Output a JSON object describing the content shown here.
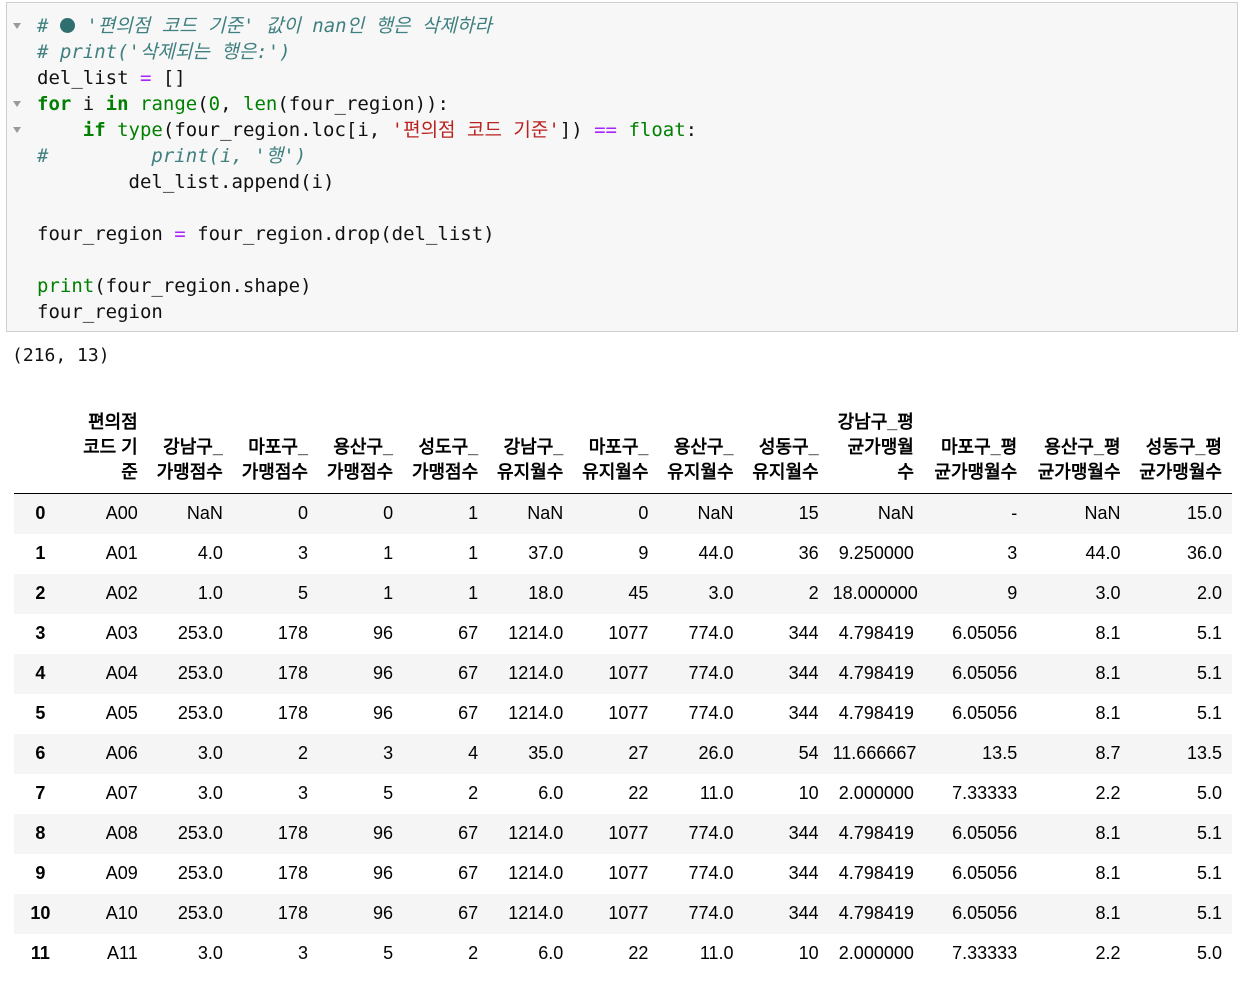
{
  "code_cell": {
    "lines": [
      [
        {
          "c": "cm",
          "t": "# "
        },
        {
          "c": "icon",
          "n": "dot-icon"
        },
        {
          "c": "cm",
          "t": " '편의점 코드 기준' 값이 nan인 행은 삭제하라"
        }
      ],
      [
        {
          "c": "cm",
          "t": "# print('삭제되는 행은:')"
        }
      ],
      [
        {
          "c": "",
          "t": "del_list "
        },
        {
          "c": "op",
          "t": "="
        },
        {
          "c": "",
          "t": " []"
        }
      ],
      [
        {
          "c": "kw",
          "t": "for"
        },
        {
          "c": "",
          "t": " i "
        },
        {
          "c": "kw",
          "t": "in"
        },
        {
          "c": "",
          "t": " "
        },
        {
          "c": "bi",
          "t": "range"
        },
        {
          "c": "",
          "t": "("
        },
        {
          "c": "nm",
          "t": "0"
        },
        {
          "c": "",
          "t": ", "
        },
        {
          "c": "bi",
          "t": "len"
        },
        {
          "c": "",
          "t": "(four_region)):"
        }
      ],
      [
        {
          "c": "",
          "t": "    "
        },
        {
          "c": "kw",
          "t": "if"
        },
        {
          "c": "",
          "t": " "
        },
        {
          "c": "bi",
          "t": "type"
        },
        {
          "c": "",
          "t": "(four_region.loc[i, "
        },
        {
          "c": "st",
          "t": "'편의점 코드 기준'"
        },
        {
          "c": "",
          "t": "]) "
        },
        {
          "c": "op",
          "t": "=="
        },
        {
          "c": "",
          "t": " "
        },
        {
          "c": "bi",
          "t": "float"
        },
        {
          "c": "",
          "t": ":"
        }
      ],
      [
        {
          "c": "cm",
          "t": "#         print(i, '행')"
        }
      ],
      [
        {
          "c": "",
          "t": "        del_list.append(i)"
        }
      ],
      [
        {
          "c": "",
          "t": ""
        }
      ],
      [
        {
          "c": "",
          "t": "four_region "
        },
        {
          "c": "op",
          "t": "="
        },
        {
          "c": "",
          "t": " four_region.drop(del_list)"
        }
      ],
      [
        {
          "c": "",
          "t": ""
        }
      ],
      [
        {
          "c": "bi",
          "t": "print"
        },
        {
          "c": "",
          "t": "(four_region.shape)"
        }
      ],
      [
        {
          "c": "",
          "t": "four_region"
        }
      ]
    ]
  },
  "stdout": "(216, 13)",
  "dataframe": {
    "columns": [
      "편의점 코드 기준",
      "강남구_가맹점수",
      "마포구_가맹점수",
      "용산구_가맹점수",
      "성도구_가맹점수",
      "강남구_유지월수",
      "마포구_유지월수",
      "용산구_유지월수",
      "성동구_유지월수",
      "강남구_평균가맹월수",
      "마포구_평균가맹월수",
      "용산구_평균가맹월수",
      "성동구_평균가맹월수"
    ],
    "rows": [
      {
        "index": "0",
        "values": [
          "A00",
          "NaN",
          "0",
          "0",
          "1",
          "NaN",
          "0",
          "NaN",
          "15",
          "NaN",
          "-",
          "NaN",
          "15.0"
        ]
      },
      {
        "index": "1",
        "values": [
          "A01",
          "4.0",
          "3",
          "1",
          "1",
          "37.0",
          "9",
          "44.0",
          "36",
          "9.250000",
          "3",
          "44.0",
          "36.0"
        ]
      },
      {
        "index": "2",
        "values": [
          "A02",
          "1.0",
          "5",
          "1",
          "1",
          "18.0",
          "45",
          "3.0",
          "2",
          "18.000000",
          "9",
          "3.0",
          "2.0"
        ]
      },
      {
        "index": "3",
        "values": [
          "A03",
          "253.0",
          "178",
          "96",
          "67",
          "1214.0",
          "1077",
          "774.0",
          "344",
          "4.798419",
          "6.05056",
          "8.1",
          "5.1"
        ]
      },
      {
        "index": "4",
        "values": [
          "A04",
          "253.0",
          "178",
          "96",
          "67",
          "1214.0",
          "1077",
          "774.0",
          "344",
          "4.798419",
          "6.05056",
          "8.1",
          "5.1"
        ]
      },
      {
        "index": "5",
        "values": [
          "A05",
          "253.0",
          "178",
          "96",
          "67",
          "1214.0",
          "1077",
          "774.0",
          "344",
          "4.798419",
          "6.05056",
          "8.1",
          "5.1"
        ]
      },
      {
        "index": "6",
        "values": [
          "A06",
          "3.0",
          "2",
          "3",
          "4",
          "35.0",
          "27",
          "26.0",
          "54",
          "11.666667",
          "13.5",
          "8.7",
          "13.5"
        ]
      },
      {
        "index": "7",
        "values": [
          "A07",
          "3.0",
          "3",
          "5",
          "2",
          "6.0",
          "22",
          "11.0",
          "10",
          "2.000000",
          "7.33333",
          "2.2",
          "5.0"
        ]
      },
      {
        "index": "8",
        "values": [
          "A08",
          "253.0",
          "178",
          "96",
          "67",
          "1214.0",
          "1077",
          "774.0",
          "344",
          "4.798419",
          "6.05056",
          "8.1",
          "5.1"
        ]
      },
      {
        "index": "9",
        "values": [
          "A09",
          "253.0",
          "178",
          "96",
          "67",
          "1214.0",
          "1077",
          "774.0",
          "344",
          "4.798419",
          "6.05056",
          "8.1",
          "5.1"
        ]
      },
      {
        "index": "10",
        "values": [
          "A10",
          "253.0",
          "178",
          "96",
          "67",
          "1214.0",
          "1077",
          "774.0",
          "344",
          "4.798419",
          "6.05056",
          "8.1",
          "5.1"
        ]
      },
      {
        "index": "11",
        "values": [
          "A11",
          "3.0",
          "3",
          "5",
          "2",
          "6.0",
          "22",
          "11.0",
          "10",
          "2.000000",
          "7.33333",
          "2.2",
          "5.0"
        ]
      }
    ]
  }
}
